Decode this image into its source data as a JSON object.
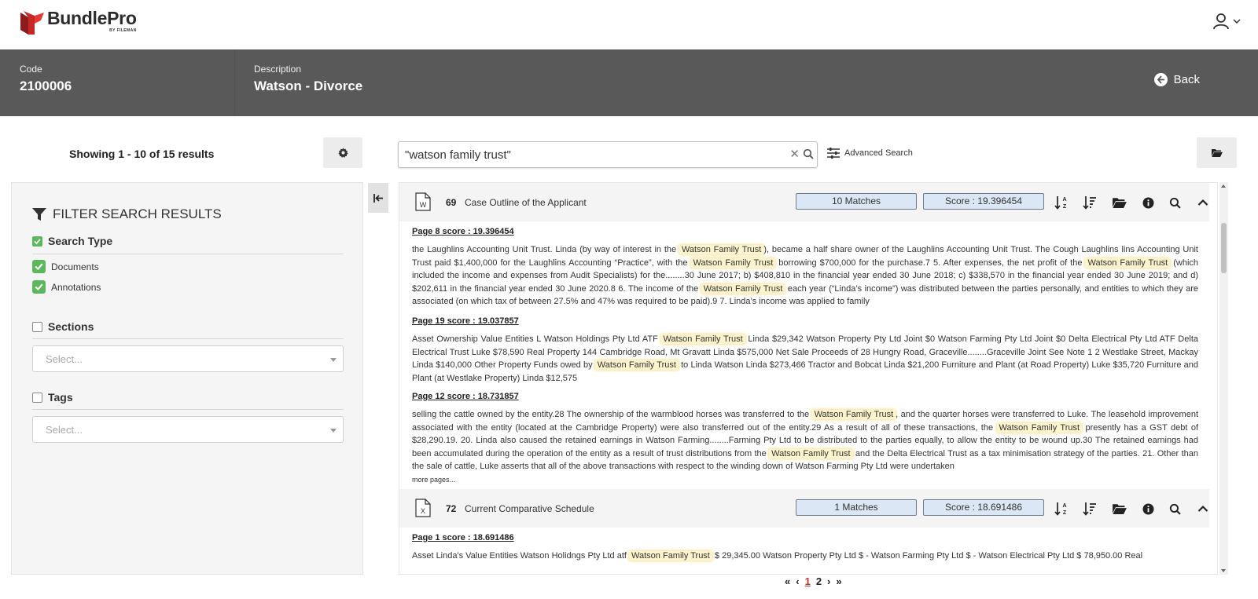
{
  "app": {
    "brand_main": "BundlePro",
    "brand_sub": "BY FILEMAN"
  },
  "matter": {
    "code_label": "Code",
    "code_value": "2100006",
    "description_label": "Description",
    "description_value": "Watson - Divorce",
    "back_label": "Back"
  },
  "toolbar": {
    "showing_text": "Showing 1 - 10 of 15 results",
    "search_value": "\"watson family trust\"",
    "advanced_search_label": "Advanced Search"
  },
  "filters": {
    "title": "FILTER SEARCH RESULTS",
    "search_type_label": "Search Type",
    "search_type_checked": true,
    "documents_label": "Documents",
    "annotations_label": "Annotations",
    "sections_label": "Sections",
    "sections_placeholder": "Select...",
    "tags_label": "Tags",
    "tags_placeholder": "Select..."
  },
  "results": [
    {
      "doc_type": "word",
      "number": "69",
      "title": "Case Outline of the Applicant",
      "matches": "10 Matches",
      "score": "Score : 19.396454",
      "pages": [
        {
          "heading": "Page 8 score : 19.396454",
          "segments": [
            "the Laughlins Accounting Unit Trust. Linda (by way of interest in the ",
            "Watson Family Trust",
            "), became a half share owner of the Laughlins Accounting Unit Trust. The Cough Laughlins lins Accounting Unit Trust paid $1,400,000 for the Laughlins Accounting “Practice”, with the ",
            "Watson Family Trust",
            " borrowing $700,000 for the purchase.7 5. After expenses, the net profit of the ",
            "Watson Family Trust",
            " (which included the income and expenses from Audit Specialists) for the........30 June 2017; b) $408,810 in the financial year ended 30 June 2018; c) $338,570 in the financial year ended 30 June 2019; and d) $202,611 in the financial year ended 30 June 2020.8 6. The income of the ",
            "Watson Family Trust",
            " each year (“Linda’s income”) was distributed between the parties personally, and entities to which they are associated (on which tax of between 27.5% and 47% was required to be paid).9 7. Linda’s income was applied to family"
          ]
        },
        {
          "heading": "Page 19 score : 19.037857",
          "segments": [
            "Asset Ownership Value Entities L Watson Holdings Pty Ltd ATF ",
            "Watson Family Trust",
            " Linda $29,342 Watson Property Pty Ltd Joint $0 Watson Farming Pty Ltd Joint $0 Delta Electrical Pty Ltd ATF Delta Electrical Trust Luke $78,590 Real Property 144 Cambridge Road, Mt Gravatt Linda $575,000 Net Sale Proceeds of 28 Hungry Road, Graceville........Graceville Joint See Note 1 2 Westlake Street, Mackay Linda $140,000 Other Property Funds owed by ",
            "Watson Family Trust",
            " to Linda Watson Linda $273,466 Tractor and Bobcat Linda $21,200 Furniture and Plant (at Road Property) Luke $35,720 Furniture and Plant (at Westlake Property) Linda $12,575"
          ]
        },
        {
          "heading": "Page 12 score : 18.731857",
          "segments": [
            "selling the cattle owned by the entity.28 The ownership of the warmblood horses was transferred to the ",
            "Watson Family Trust",
            ", and the quarter horses were transferred to Luke. The leasehold improvement associated with the entity (located at the Cambridge Property) were also transferred out of the entity.29 As a result of all of these transactions, the ",
            "Watson Family Trust",
            " presently has a GST debt of $28,290.19. 20. Linda also caused the retained earnings in Watson Farming........Farming Pty Ltd to be distributed to the parties equally, to allow the entity to be wound up.30 The retained earnings had been accumulated during the operation of the entity as a result of trust distributions from the ",
            "Watson Family Trust",
            " and the Delta Electrical Trust as a tax minimisation strategy of the parties. 21. Other than the sale of cattle, Luke asserts that all of the above transactions with respect to the winding down of Watson Farming Pty Ltd were undertaken"
          ]
        }
      ],
      "more_label": "more pages..."
    },
    {
      "doc_type": "excel",
      "number": "72",
      "title": "Current Comparative Schedule",
      "matches": "1 Matches",
      "score": "Score : 18.691486",
      "pages": [
        {
          "heading": "Page 1 score : 18.691486",
          "segments": [
            "Asset Linda's Value Entities Watson Holidngs Pty Ltd atf ",
            "Watson Family Trust",
            " $ 29,345.00 Watson Property Pty Ltd $ - Watson Farming Pty Ltd $ - Watson Electrical Pty Ltd $ 78,950.00 Real"
          ]
        }
      ]
    }
  ],
  "pagination": {
    "first": "«",
    "prev": "‹",
    "page1": "1",
    "page2": "2",
    "next": "›",
    "last": "»"
  },
  "colors": {
    "header_band": "#595959",
    "check_green": "#5cb85c",
    "pill_blue": "#dbe7f4",
    "highlight": "#fdf3cc",
    "brand_red": "#c62828"
  },
  "icons": {
    "user": "user-icon",
    "gear": "gear-icon",
    "search": "search-icon",
    "clear": "close-icon",
    "advanced": "sliders-icon",
    "folder": "folder-open-icon",
    "filter": "filter-icon",
    "collapse": "collapse-left-icon",
    "sort_alpha": "sort-alpha-icon",
    "sort_amount": "sort-amount-icon",
    "info": "info-icon",
    "chevron_up": "chevron-up-icon"
  }
}
